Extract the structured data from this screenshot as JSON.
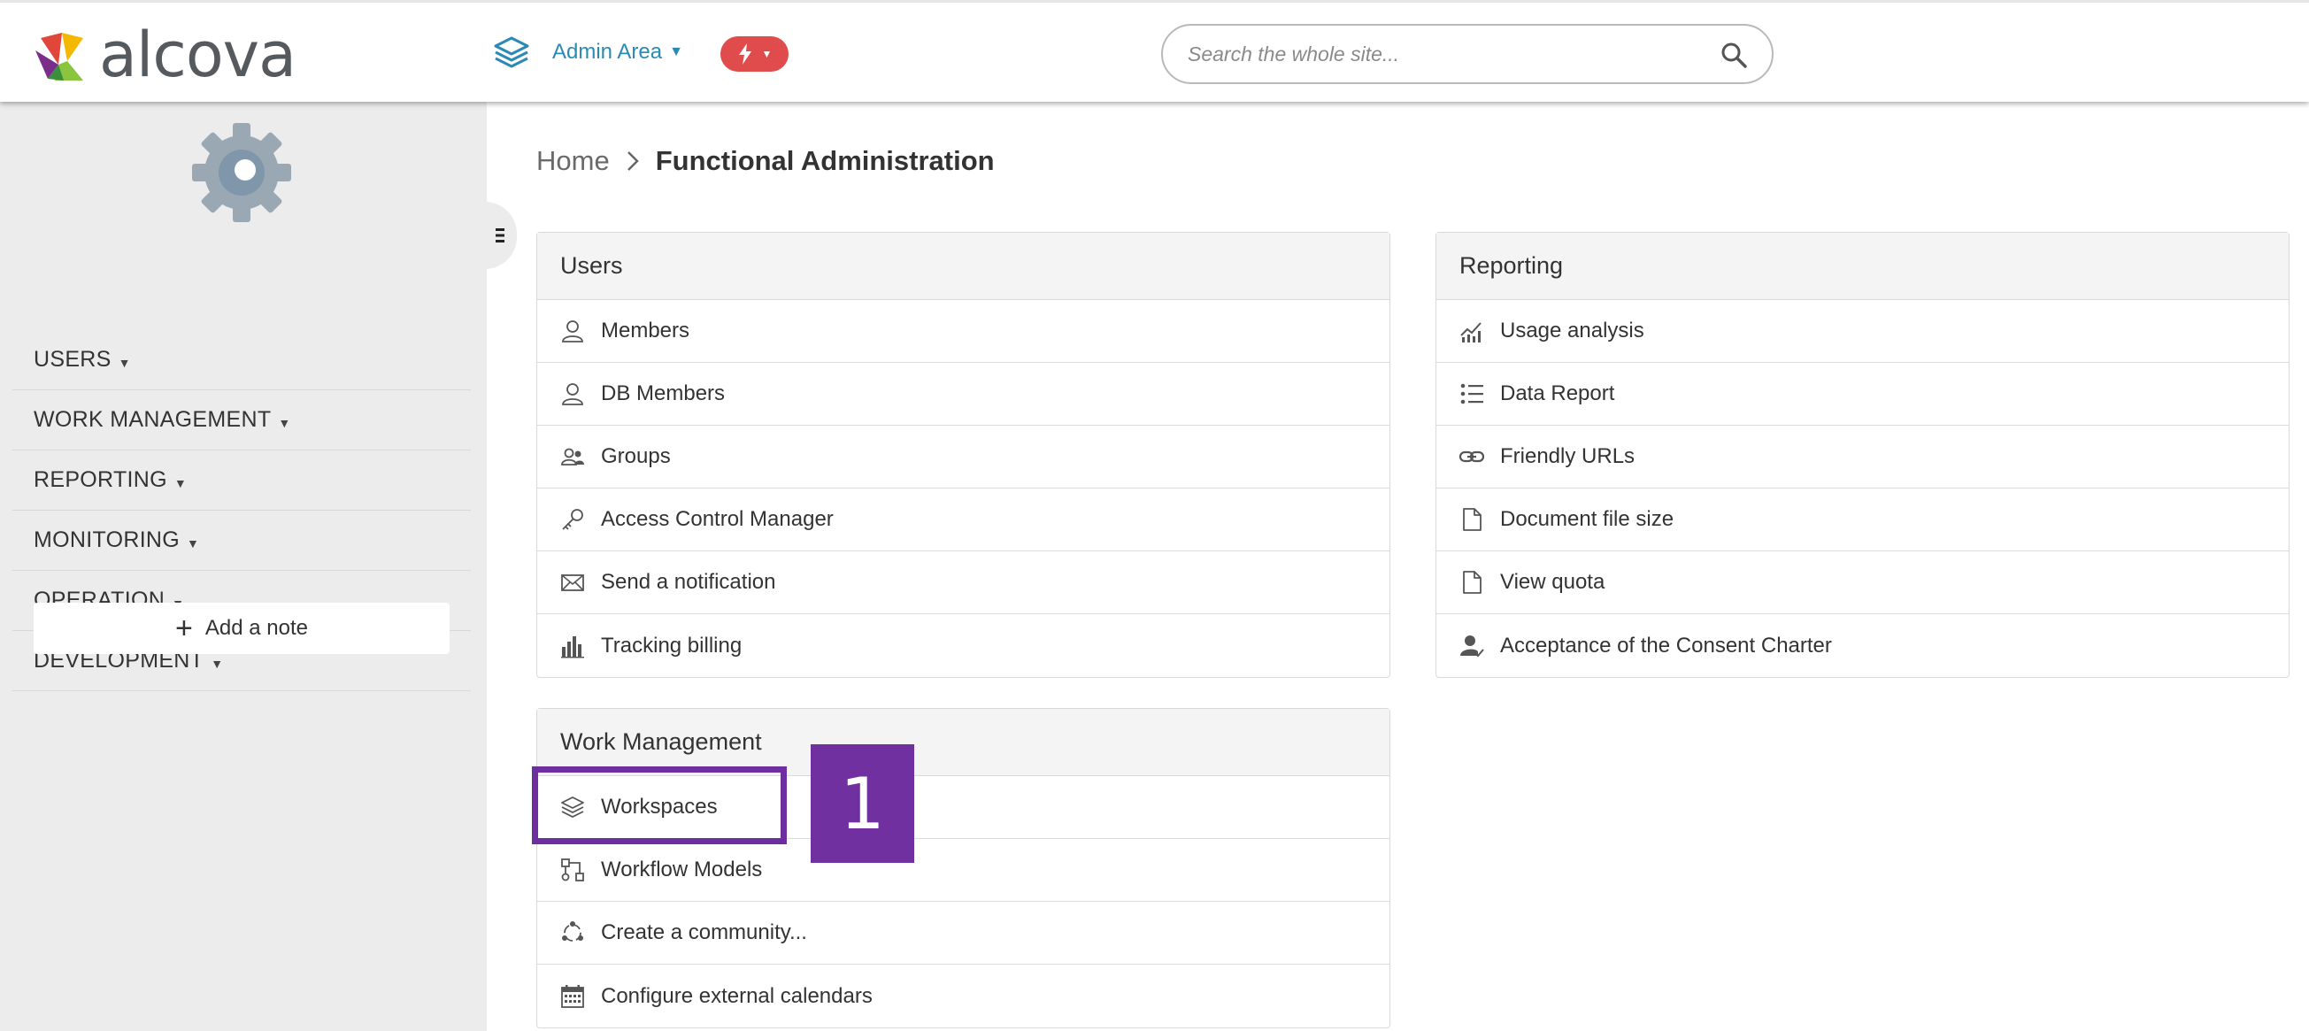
{
  "header": {
    "logo_text": "alcova",
    "area_label": "Admin Area",
    "quick_icon": "lightning-icon",
    "search_placeholder": "Search the whole site..."
  },
  "sidebar": {
    "items": [
      {
        "label": "USERS"
      },
      {
        "label": "WORK MANAGEMENT"
      },
      {
        "label": "REPORTING"
      },
      {
        "label": "MONITORING"
      },
      {
        "label": "OPERATION"
      },
      {
        "label": "DEVELOPMENT"
      }
    ],
    "add_note_label": "Add a note"
  },
  "breadcrumb": {
    "home": "Home",
    "current": "Functional Administration"
  },
  "panels": {
    "users": {
      "title": "Users",
      "items": [
        {
          "label": "Members",
          "icon": "user-icon"
        },
        {
          "label": "DB Members",
          "icon": "user-icon"
        },
        {
          "label": "Groups",
          "icon": "group-icon"
        },
        {
          "label": "Access Control Manager",
          "icon": "key-icon"
        },
        {
          "label": "Send a notification",
          "icon": "envelope-icon"
        },
        {
          "label": "Tracking billing",
          "icon": "bar-chart-icon"
        }
      ]
    },
    "reporting": {
      "title": "Reporting",
      "items": [
        {
          "label": "Usage analysis",
          "icon": "line-chart-icon"
        },
        {
          "label": "Data Report",
          "icon": "list-icon"
        },
        {
          "label": "Friendly URLs",
          "icon": "link-icon"
        },
        {
          "label": "Document file size",
          "icon": "document-icon"
        },
        {
          "label": "View quota",
          "icon": "document-icon"
        },
        {
          "label": "Acceptance of the Consent Charter",
          "icon": "user-check-icon"
        }
      ]
    },
    "work_management": {
      "title": "Work Management",
      "items": [
        {
          "label": "Workspaces",
          "icon": "layers-icon"
        },
        {
          "label": "Workflow Models",
          "icon": "workflow-icon"
        },
        {
          "label": "Create a community...",
          "icon": "community-icon"
        },
        {
          "label": "Configure external calendars",
          "icon": "calendar-icon"
        }
      ]
    }
  },
  "callout": {
    "number": "1",
    "color": "#7030a0"
  },
  "colors": {
    "accent": "#2a8ab5",
    "quick_button": "#e04b4b",
    "sidebar_bg": "#ececec"
  }
}
